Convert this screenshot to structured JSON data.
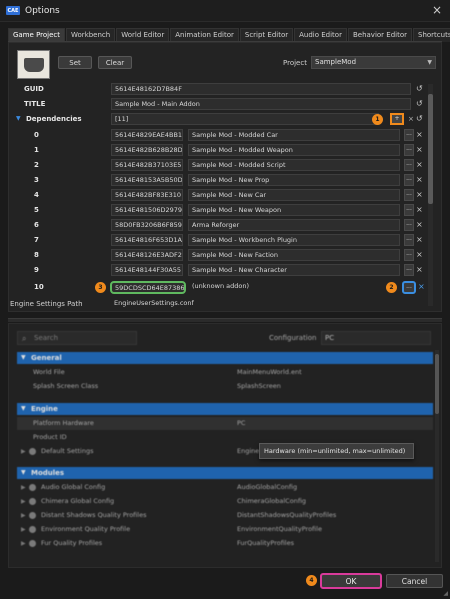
{
  "window": {
    "logo_text": "CAE",
    "title": "Options",
    "close_icon": "×"
  },
  "tabs": [
    {
      "label": "Game Project",
      "active": true
    },
    {
      "label": "Workbench"
    },
    {
      "label": "World Editor"
    },
    {
      "label": "Animation Editor"
    },
    {
      "label": "Script Editor"
    },
    {
      "label": "Audio Editor"
    },
    {
      "label": "Behavior Editor"
    },
    {
      "label": "Shortcuts"
    }
  ],
  "game_project": {
    "set_label": "Set",
    "clear_label": "Clear",
    "project_label": "Project",
    "project_value": "SampleMod",
    "rows": [
      {
        "label": "GUID",
        "value": "5614E48162D7B84F"
      },
      {
        "label": "TITLE",
        "value": "Sample Mod - Main Addon"
      },
      {
        "label": "Dependencies",
        "value": "[11]"
      }
    ],
    "dependencies": [
      {
        "index": "0",
        "guid": "5614E4829EAE4BB1",
        "name": "Sample Mod - Modded Car"
      },
      {
        "index": "1",
        "guid": "5614E482B628B28D",
        "name": "Sample Mod - Modded Weapon"
      },
      {
        "index": "2",
        "guid": "5614E482B37103E5",
        "name": "Sample Mod - Modded Script"
      },
      {
        "index": "3",
        "guid": "5614E48153A5B50D",
        "name": "Sample Mod - New Prop"
      },
      {
        "index": "4",
        "guid": "5614E482BF83E310",
        "name": "Sample Mod - New Car"
      },
      {
        "index": "5",
        "guid": "5614E481506D2979",
        "name": "Sample Mod - New Weapon"
      },
      {
        "index": "6",
        "guid": "58D0FB3206B6F859",
        "name": "Arma Reforger"
      },
      {
        "index": "7",
        "guid": "5614E4816F653D1A",
        "name": "Sample Mod - Workbench Plugin"
      },
      {
        "index": "8",
        "guid": "5614E48126E3ADF2",
        "name": "Sample Mod - New Faction"
      },
      {
        "index": "9",
        "guid": "5614E48144F30A55",
        "name": "Sample Mod - New Character"
      },
      {
        "index": "10",
        "guid": "59DCDSCD64E87386",
        "name": "(unknown addon)"
      }
    ],
    "engine_settings_label": "Engine Settings Path",
    "engine_settings_value": "EngineUserSettings.conf",
    "badges": {
      "one": "1",
      "two": "2",
      "three": "3",
      "four": "4"
    },
    "dots_label": "...",
    "plus_label": "+",
    "reset_icon": "↺"
  },
  "engine_settings": {
    "search_placeholder": "Search",
    "configuration_label": "Configuration",
    "configuration_value": "PC",
    "sections": {
      "general": "General",
      "engine": "Engine",
      "modules": "Modules"
    },
    "general_rows": [
      {
        "key": "World File",
        "value": "MainMenuWorld.ent"
      },
      {
        "key": "Splash Screen Class",
        "value": "SplashScreen"
      }
    ],
    "engine_rows": [
      {
        "key": "Platform Hardware",
        "value": "PC"
      },
      {
        "key": "Product ID",
        "value": ""
      },
      {
        "key": "Default Settings",
        "value": "Engine"
      }
    ],
    "module_rows": [
      {
        "key": "Audio Global Config",
        "value": "AudioGlobalConfig"
      },
      {
        "key": "Chimera Global Config",
        "value": "ChimeraGlobalConfig"
      },
      {
        "key": "Distant Shadows Quality Profiles",
        "value": "DistantShadowsQualityProfiles"
      },
      {
        "key": "Environment Quality Profile",
        "value": "EnvironmentQualityProfile"
      },
      {
        "key": "Fur Quality Profiles",
        "value": "FurQualityProfiles"
      }
    ],
    "tooltip": "Hardware (min=unlimited, max=unlimited)"
  },
  "footer": {
    "ok_label": "OK",
    "cancel_label": "Cancel"
  },
  "colors": {
    "accent_orange": "#f08a1c",
    "accent_blue": "#1f6fc6",
    "ok_border": "#d93b9b",
    "green_outline": "#5fb85f"
  }
}
